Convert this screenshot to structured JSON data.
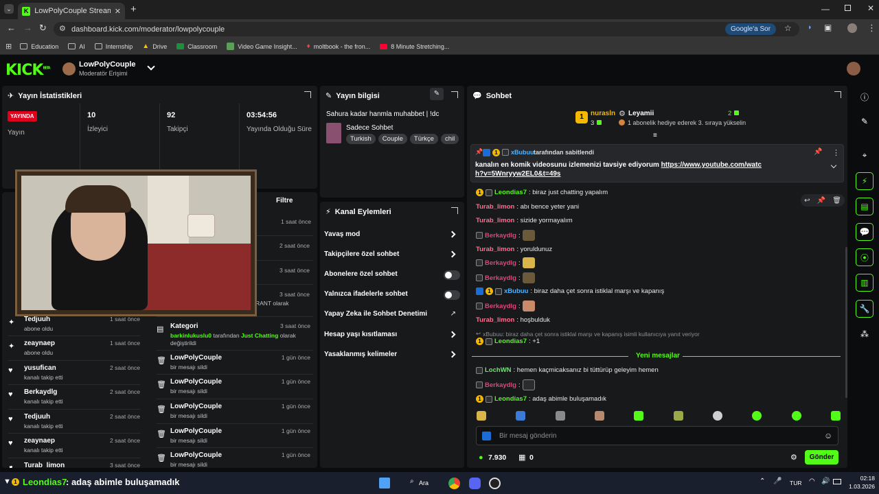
{
  "browser": {
    "tab_title": "LowPolyCouple Stream - Kick D",
    "url": "dashboard.kick.com/moderator/lowpolycouple",
    "google_btn": "Google'a Sor",
    "bookmarks": [
      "Education",
      "AI",
      "Internship",
      "Drive",
      "Classroom",
      "Video Game Insight...",
      "moltbook - the fron...",
      "8 Minute Stretching..."
    ]
  },
  "header": {
    "channel_name": "LowPolyCouple",
    "role": "Moderatör Erişimi"
  },
  "stats": {
    "title": "Yayın İstatistikleri",
    "live_badge": "YAYINDA",
    "live_label": "Yayın",
    "viewers": "10",
    "viewers_label": "İzleyici",
    "followers": "92",
    "followers_label": "Takipçi",
    "uptime": "03:54:56",
    "uptime_label": "Yayında Olduğu Süre"
  },
  "activity": {
    "filter": "Filtre",
    "times_top": [
      "1 saat önce",
      "2 saat önce",
      "3 saat önce",
      "3 saat önce"
    ],
    "partial_text": "RANT olarak",
    "left_events": [
      {
        "name": "Tedjuuh",
        "sub": "abone oldu",
        "time": "1 saat önce"
      },
      {
        "name": "zeaynaep",
        "sub": "abone oldu",
        "time": "1 saat önce"
      },
      {
        "name": "yusufican",
        "sub": "kanalı takip etti",
        "time": "2 saat önce"
      },
      {
        "name": "Berkaydlg",
        "sub": "kanalı takip etti",
        "time": "2 saat önce"
      },
      {
        "name": "Tedjuuh",
        "sub": "kanalı takip etti",
        "time": "2 saat önce"
      },
      {
        "name": "zeaynaep",
        "sub": "kanalı takip etti",
        "time": "2 saat önce"
      },
      {
        "name": "Turab_limon",
        "sub": "",
        "time": "3 saat önce"
      }
    ],
    "right_events": [
      {
        "name": "Kategori",
        "sub_a": "barkinlukuslu0",
        "sub_b": " tarafından ",
        "sub_c": "Just Chatting",
        "sub_d": " olarak değiştirildi",
        "time": "3 saat önce"
      },
      {
        "name": "LowPolyCouple",
        "sub": "bir mesajı sildi",
        "time": "1 gün önce"
      },
      {
        "name": "LowPolyCouple",
        "sub": "bir mesajı sildi",
        "time": "1 gün önce"
      },
      {
        "name": "LowPolyCouple",
        "sub": "bir mesajı sildi",
        "time": "1 gün önce"
      },
      {
        "name": "LowPolyCouple",
        "sub": "bir mesajı sildi",
        "time": "1 gün önce"
      },
      {
        "name": "LowPolyCouple",
        "sub": "bir mesajı sildi",
        "time": "1 gün önce"
      }
    ]
  },
  "stream_info": {
    "title": "Yayın bilgisi",
    "stream_title": "Sahura kadar hanmla muhabbet | !dc",
    "category": "Sadece Sohbet",
    "tags": [
      "Turkish",
      "Couple",
      "Türkçe",
      "chil"
    ]
  },
  "actions": {
    "title": "Kanal Eylemleri",
    "items": [
      {
        "label": "Yavaş mod"
      },
      {
        "label": "Takipçilere özel sohbet"
      },
      {
        "label": "Abonelere özel sohbet"
      },
      {
        "label": "Yalnızca ifadelerle sohbet"
      },
      {
        "label": "Yapay Zeka ile Sohbet Denetimi"
      },
      {
        "label": "Hesap yaşı kısıtlaması"
      },
      {
        "label": "Yasaklanmış kelimeler"
      }
    ]
  },
  "chat": {
    "title": "Sohbet",
    "leader1": "nurasln",
    "leader1_count": "3",
    "leader2": "Leyamii",
    "leader2_count": "2",
    "gift_note": "1 abonelik hediye ederek 3. sıraya yükselin",
    "pinned_by_user": "xBubuu",
    "pinned_by_text": "tarafından sabitlendi",
    "pinned_text": "kanalın en komik videosunu izlemenizi tavsiye ediyorum",
    "pinned_link": "https://www.youtube.com/watch?v=5Wnryyw2EL0&t=49s",
    "messages": [
      {
        "user": "Leondias7",
        "text": ": biraz just chatting yapalım",
        "color": "#53fc18"
      },
      {
        "user": "Turab_limon",
        "text": ": abı bence yeter yani",
        "color": "#ff6f91"
      },
      {
        "user": "Turab_limon",
        "text": ": sizide yormayalım",
        "color": "#ff6f91"
      },
      {
        "user": "Berkaydlg",
        "text": ":",
        "color": "#e0457b"
      },
      {
        "user": "Turab_limon",
        "text": ": yoruldunuz",
        "color": "#ff6f91"
      },
      {
        "user": "Berkaydlg",
        "text": ":",
        "color": "#e0457b"
      },
      {
        "user": "Berkaydlg",
        "text": ":",
        "color": "#e0457b"
      },
      {
        "user": "xBubuu",
        "text": ": biraz daha çet sonra istiklal marşı ve kapanış",
        "color": "#4fb5ff"
      },
      {
        "user": "Berkaydlg",
        "text": ":",
        "color": "#e0457b"
      },
      {
        "user": "Turab_limon",
        "text": ": hoşbulduk",
        "color": "#ff6f91"
      }
    ],
    "reply_ref": "xBubuu: biraz daha çet sonra istiklal marşı ve kapanış isimli kullanıcıya yanıt veriyor",
    "reply_user": "Leondias7",
    "reply_text": ": +1",
    "new_messages": "Yeni mesajlar",
    "new_msgs": [
      {
        "user": "LochWN",
        "text": ": hemen kaçmicaksanız bi tüttürüp geleyim hemen",
        "color": "#7be07b"
      },
      {
        "user": "Berkaydlg",
        "text": ":",
        "color": "#e0457b"
      },
      {
        "user": "Leondias7",
        "text": ": adaş abimle buluşamadık",
        "color": "#53fc18"
      }
    ],
    "input_placeholder": "Bir mesaj gönderin",
    "points": "7.930",
    "store_count": "0",
    "send": "Gönder"
  },
  "taskbar": {
    "ticker_user": "Leondias7",
    "ticker_text": ": adaş abimle buluşamadık",
    "search": "Ara",
    "lang": "TUR",
    "time": "02:18",
    "date": "1.03.2026"
  },
  "colors": {
    "accent": "#53fc18",
    "live": "#e0001b"
  }
}
